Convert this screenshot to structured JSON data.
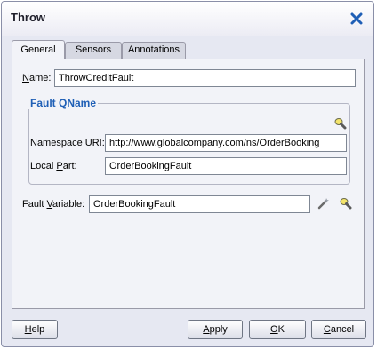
{
  "dialog": {
    "title": "Throw"
  },
  "tabs": [
    {
      "label": "General",
      "active": true
    },
    {
      "label": "Sensors",
      "active": false
    },
    {
      "label": "Annotations",
      "active": false
    }
  ],
  "general": {
    "name_label_mnemonic": "N",
    "name_label_rest": "ame:",
    "name_value": "ThrowCreditFault",
    "fault_qname_title": "Fault QName",
    "namespace_label_pre": "Namespace ",
    "namespace_label_mnemonic": "U",
    "namespace_label_post": "RI:",
    "namespace_value": "http://www.globalcompany.com/ns/OrderBooking",
    "local_part_label_pre": "Local ",
    "local_part_label_mnemonic": "P",
    "local_part_label_post": "art:",
    "local_part_value": "OrderBookingFault",
    "fault_variable_label_pre": "Fault ",
    "fault_variable_label_mnemonic": "V",
    "fault_variable_label_post": "ariable:",
    "fault_variable_value": "OrderBookingFault"
  },
  "buttons": {
    "help_mnemonic": "H",
    "help_rest": "elp",
    "apply_mnemonic": "A",
    "apply_rest": "pply",
    "ok_mnemonic": "O",
    "ok_rest": "K",
    "cancel_mnemonic": "C",
    "cancel_rest": "ancel"
  },
  "icons": {
    "close": "close-x-icon",
    "browse_fault": "flashlight-icon",
    "create_variable": "wand-icon",
    "browse_variable": "flashlight-icon"
  },
  "colors": {
    "close_icon": "#1f5fb6",
    "group_title": "#1f5fb6",
    "dialog_bg": "#e6e8f2",
    "panel_bg": "#f2f3f8"
  }
}
